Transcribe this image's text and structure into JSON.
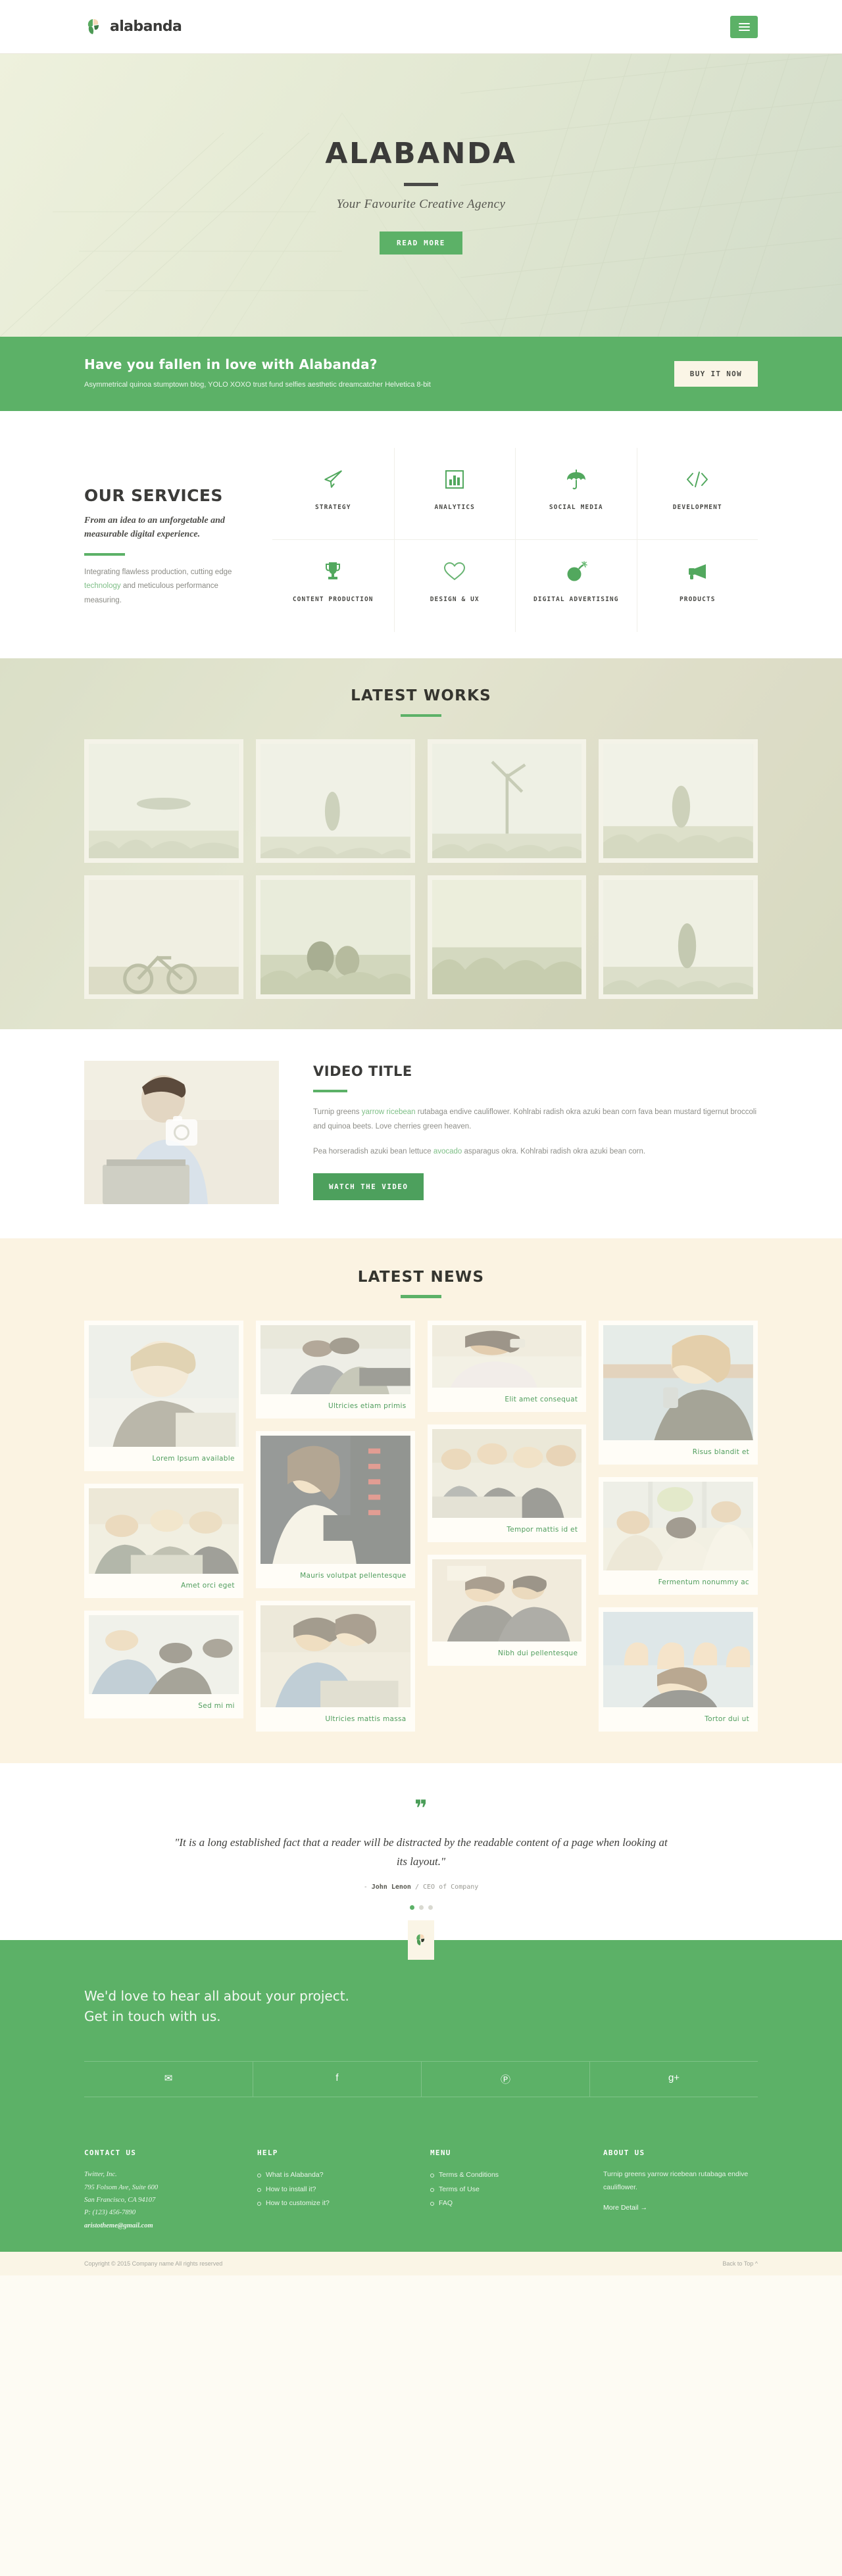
{
  "header": {
    "brand": "alabanda",
    "menu_icon": "hamburger-menu-icon"
  },
  "hero": {
    "title": "ALABANDA",
    "subtitle": "Your Favourite Creative Agency",
    "button": "READ MORE"
  },
  "cta": {
    "title": "Have you fallen in love with Alabanda?",
    "subtitle": "Asymmetrical quinoa stumptown blog, YOLO XOXO trust fund selfies aesthetic dreamcatcher Helvetica 8-bit",
    "button": "BUY IT NOW"
  },
  "services": {
    "heading": "OUR SERVICES",
    "lead": "From an idea to an unforgetable and measurable digital experience.",
    "body_before": "Integrating flawless production, cutting edge ",
    "body_link": "technology",
    "body_after": " and meticulous performance measuring.",
    "items": [
      {
        "label": "STRATEGY",
        "icon": "paper-plane-icon"
      },
      {
        "label": "ANALYTICS",
        "icon": "bar-chart-icon"
      },
      {
        "label": "SOCIAL MEDIA",
        "icon": "umbrella-icon"
      },
      {
        "label": "DEVELOPMENT",
        "icon": "code-icon"
      },
      {
        "label": "CONTENT PRODUCTION",
        "icon": "trophy-icon"
      },
      {
        "label": "DESIGN & UX",
        "icon": "heart-icon"
      },
      {
        "label": "DIGITAL ADVERTISING",
        "icon": "bomb-icon"
      },
      {
        "label": "PRODUCTS",
        "icon": "megaphone-icon"
      }
    ]
  },
  "works": {
    "heading": "LATEST WORKS",
    "thumbs": [
      "beach-dune-grass",
      "child-on-dune",
      "wind-turbine-dune",
      "field-grass-sky",
      "bicycle-on-path",
      "couple-sitting-grass",
      "grass-field-wide",
      "woman-walking-dune"
    ]
  },
  "video": {
    "heading": "VIDEO TITLE",
    "thumb": "man-with-laptop",
    "camera_icon": "camera-icon",
    "p1_a": "Turnip greens ",
    "p1_link": "yarrow ricebean",
    "p1_b": " rutabaga endive cauliflower. Kohlrabi radish okra azuki bean corn fava bean mustard tigernut broccoli and quinoa beets. Love cherries green heaven.",
    "p2_a": "Pea horseradish azuki bean lettuce ",
    "p2_link": "avocado",
    "p2_b": " asparagus okra. Kohlrabi radish okra azuki bean corn.",
    "button": "WATCH THE VIDEO"
  },
  "news": {
    "heading": "LATEST NEWS",
    "columns": [
      [
        {
          "caption": "Lorem Ipsum available",
          "h": 185,
          "img": "woman-on-phone"
        },
        {
          "caption": "Amet orci eget",
          "h": 130,
          "img": "office-meeting-three"
        },
        {
          "caption": "Sed mi mi",
          "h": 120,
          "img": "team-desk-work"
        }
      ],
      [
        {
          "caption": "Ultricies etiam primis",
          "h": 105,
          "img": "two-colleagues-laptop"
        },
        {
          "caption": "Mauris volutpat pellentesque",
          "h": 195,
          "img": "woman-with-notebook"
        },
        {
          "caption": "Ultricies mattis massa",
          "h": 155,
          "img": "couple-at-laptop"
        }
      ],
      [
        {
          "caption": "Elit amet consequat",
          "h": 95,
          "img": "woman-laughing-phone"
        },
        {
          "caption": "Tempor mattis id et",
          "h": 135,
          "img": "boardroom-meeting"
        },
        {
          "caption": "Nibh dui pellentesque",
          "h": 125,
          "img": "two-men-document"
        }
      ],
      [
        {
          "caption": "Risus blandit et",
          "h": 175,
          "img": "woman-mobile-river"
        },
        {
          "caption": "Fermentum nonummy ac",
          "h": 135,
          "img": "office-window-desks"
        },
        {
          "caption": "Tortor dui ut",
          "h": 145,
          "img": "thumbs-up-team"
        }
      ]
    ]
  },
  "testimonial": {
    "quote_icon": "quotation-mark-icon",
    "text": "\"It is a long established fact that a reader will be distracted by the readable content of a page when looking at its layout.\"",
    "author": "John Lenon",
    "author_prefix": "- ",
    "role": " / CEO of Company",
    "slides": 3,
    "active_slide": 0
  },
  "contact": {
    "logo_icon": "alabanda-leaf-icon",
    "line1": "We'd love to hear all about your project.",
    "line2": "Get in touch with us.",
    "social": [
      {
        "name": "twitter-icon",
        "glyph": "✉"
      },
      {
        "name": "facebook-icon",
        "glyph": "f"
      },
      {
        "name": "pinterest-icon",
        "glyph": "Ⓟ"
      },
      {
        "name": "google-plus-icon",
        "glyph": "g+"
      }
    ]
  },
  "footer": {
    "contact": {
      "title": "CONTACT US",
      "company": "Twitter, Inc.",
      "street": "795 Folsom Ave, Suite 600",
      "city": "San Francisco, CA 94107",
      "phone": "P: (123) 456-7890",
      "email": "aristotheme@gmail.com"
    },
    "help": {
      "title": "HELP",
      "items": [
        "What is Alabanda?",
        "How to install it?",
        "How to customize it?"
      ]
    },
    "menu": {
      "title": "MENU",
      "items": [
        "Terms & Conditions",
        "Terms of Use",
        "FAQ"
      ]
    },
    "about": {
      "title": "ABOUT US",
      "text": "Turnip greens yarrow ricebean rutabaga endive cauliflower.",
      "more": "More Detail →"
    },
    "copyright": "Copyright © 2015 Company name All rights reserved",
    "back_to_top": "Back to Top ^"
  },
  "colors": {
    "green": "#5cb167",
    "green_dark": "#4da05d",
    "cream": "#faf5e6",
    "news_bg": "#fbf3e2"
  }
}
